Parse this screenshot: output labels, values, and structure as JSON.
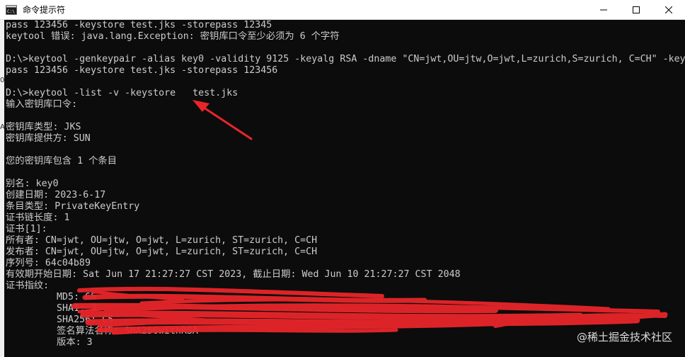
{
  "window": {
    "title": "命令提示符",
    "app_icon": "cmd-icon",
    "controls": {
      "minimize": "—",
      "maximize": "☐",
      "close": "✕"
    }
  },
  "console": {
    "lines": [
      "pass 123456 -keystore test.jks -storepass 12345",
      "keytool 错误: java.lang.Exception: 密钥库口令至少必须为 6 个字符",
      "",
      "D:\\>keytool -genkeypair -alias key0 -validity 9125 -keyalg RSA -dname \"CN=jwt,OU=jtw,O=jwt,L=zurich,S=zurich, C=CH\" -key",
      "pass 123456 -keystore test.jks -storepass 123456",
      "",
      "D:\\>keytool -list -v -keystore   test.jks",
      "输入密钥库口令:",
      "",
      "密钥库类型: JKS",
      "密钥库提供方: SUN",
      "",
      "您的密钥库包含 1 个条目",
      "",
      "别名: key0",
      "创建日期: 2023-6-17",
      "条目类型: PrivateKeyEntry",
      "证书链长度: 1",
      "证书[1]:",
      "所有者: CN=jwt, OU=jtw, O=jwt, L=zurich, ST=zurich, C=CH",
      "发布者: CN=jwt, OU=jtw, O=jwt, L=zurich, ST=zurich, C=CH",
      "序列号: 64c04b89",
      "有效期开始日期: Sat Jun 17 21:27:27 CST 2023, 截止日期: Wed Jun 10 21:27:27 CST 2048",
      "证书指纹:",
      "         MD5: 66",
      "         SHA1: 3",
      "         SHA256: C5",
      "         签名算法名称: SHA256withRSA",
      "         版本: 3"
    ]
  },
  "left_sliver": {
    "marks": [
      "05",
      "A"
    ]
  },
  "watermark": "@稀土掘金技术社区",
  "colors": {
    "console_bg": "#0c0c0c",
    "console_text": "#cccccc",
    "titlebar_bg": "#ffffff",
    "annotation": "#e8262a"
  }
}
